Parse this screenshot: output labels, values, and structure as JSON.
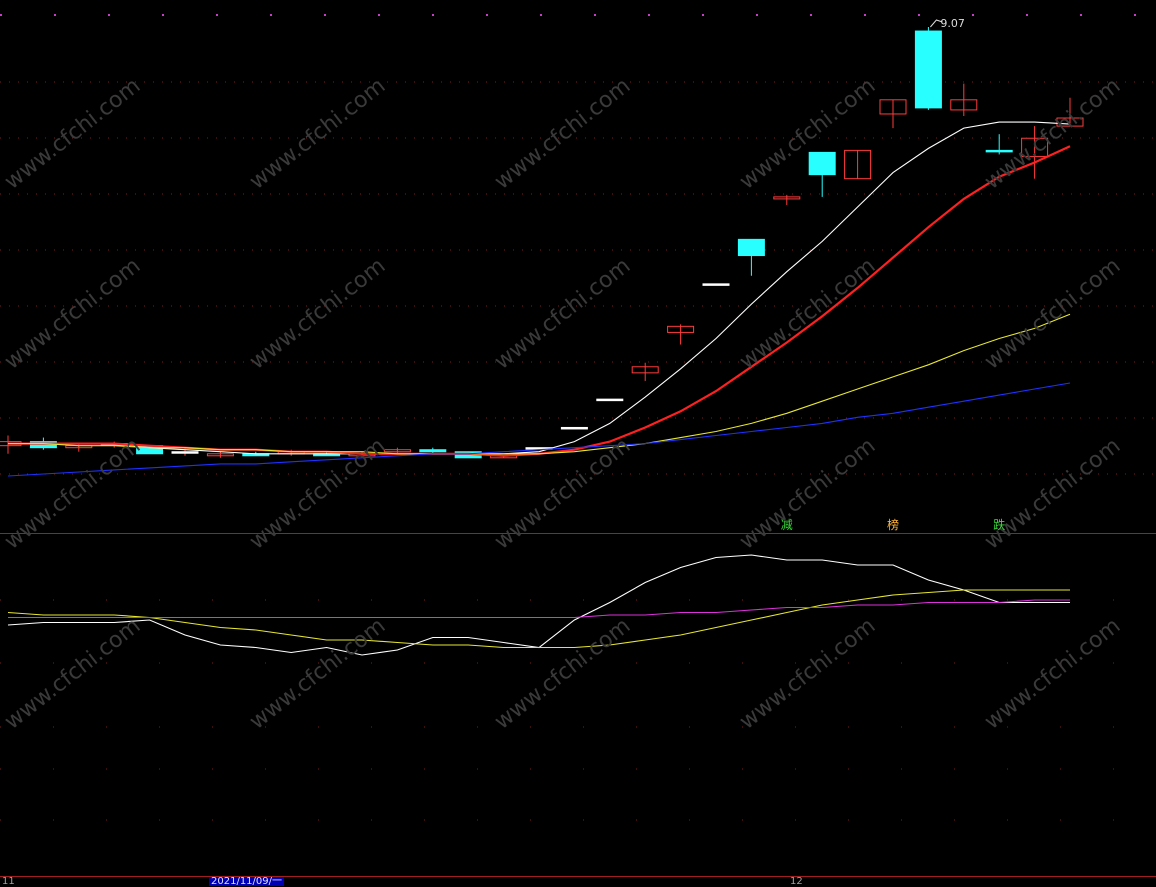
{
  "chart_data": [
    {
      "type": "candlestick",
      "panel": "main",
      "high_label": "9.07",
      "candles": [
        {
          "o": 7.02,
          "h": 7.05,
          "l": 6.96,
          "c": 7.0,
          "up": true
        },
        {
          "o": 7.02,
          "h": 7.04,
          "l": 6.98,
          "c": 6.99,
          "up": false
        },
        {
          "o": 6.99,
          "h": 7.01,
          "l": 6.97,
          "c": 7.0,
          "up": true
        },
        {
          "o": 7.01,
          "h": 7.02,
          "l": 6.99,
          "c": 7.01,
          "up": true
        },
        {
          "o": 7.0,
          "h": 7.0,
          "l": 6.96,
          "c": 6.96,
          "up": false
        },
        {
          "o": 6.97,
          "h": 6.99,
          "l": 6.95,
          "c": 6.97,
          "up": true
        },
        {
          "o": 6.96,
          "h": 6.97,
          "l": 6.94,
          "c": 6.95,
          "up": true
        },
        {
          "o": 6.96,
          "h": 6.97,
          "l": 6.95,
          "c": 6.95,
          "up": false
        },
        {
          "o": 6.96,
          "h": 6.98,
          "l": 6.95,
          "c": 6.97,
          "up": true
        },
        {
          "o": 6.96,
          "h": 6.97,
          "l": 6.95,
          "c": 6.95,
          "up": false
        },
        {
          "o": 6.95,
          "h": 6.97,
          "l": 6.94,
          "c": 6.96,
          "up": true
        },
        {
          "o": 6.97,
          "h": 6.99,
          "l": 6.96,
          "c": 6.98,
          "up": true
        },
        {
          "o": 6.98,
          "h": 6.99,
          "l": 6.96,
          "c": 6.97,
          "up": false
        },
        {
          "o": 6.97,
          "h": 6.97,
          "l": 6.94,
          "c": 6.94,
          "up": false
        },
        {
          "o": 6.94,
          "h": 6.95,
          "l": 6.94,
          "c": 6.95,
          "up": true
        },
        {
          "o": 6.99,
          "h": 6.99,
          "l": 6.99,
          "c": 6.99,
          "up": true
        },
        {
          "o": 7.09,
          "h": 7.09,
          "l": 7.09,
          "c": 7.09,
          "up": true
        },
        {
          "o": 7.23,
          "h": 7.23,
          "l": 7.23,
          "c": 7.23,
          "up": true
        },
        {
          "o": 7.36,
          "h": 7.41,
          "l": 7.32,
          "c": 7.39,
          "up": true
        },
        {
          "o": 7.56,
          "h": 7.6,
          "l": 7.5,
          "c": 7.59,
          "up": true
        },
        {
          "o": 7.8,
          "h": 7.8,
          "l": 7.8,
          "c": 7.8,
          "up": true
        },
        {
          "o": 8.02,
          "h": 8.02,
          "l": 7.84,
          "c": 7.94,
          "up": false
        },
        {
          "o": 8.22,
          "h": 8.24,
          "l": 8.19,
          "c": 8.23,
          "up": true
        },
        {
          "o": 8.45,
          "h": 8.45,
          "l": 8.23,
          "c": 8.34,
          "up": false
        },
        {
          "o": 8.32,
          "h": 8.46,
          "l": 8.32,
          "c": 8.46,
          "up": true
        },
        {
          "o": 8.64,
          "h": 8.71,
          "l": 8.57,
          "c": 8.71,
          "up": true
        },
        {
          "o": 9.05,
          "h": 9.07,
          "l": 8.66,
          "c": 8.67,
          "up": false
        },
        {
          "o": 8.66,
          "h": 8.79,
          "l": 8.63,
          "c": 8.71,
          "up": true
        },
        {
          "o": 8.46,
          "h": 8.54,
          "l": 8.44,
          "c": 8.46,
          "up": false
        },
        {
          "o": 8.43,
          "h": 8.58,
          "l": 8.32,
          "c": 8.52,
          "up": true
        },
        {
          "o": 8.58,
          "h": 8.72,
          "l": 8.58,
          "c": 8.62,
          "up": true
        }
      ],
      "series": [
        {
          "color": "#ffffff",
          "values": [
            7.01,
            7.01,
            7.01,
            7.01,
            6.99,
            6.98,
            6.97,
            6.96,
            6.96,
            6.96,
            6.96,
            6.96,
            6.96,
            6.96,
            6.96,
            6.97,
            7.02,
            7.11,
            7.24,
            7.38,
            7.53,
            7.7,
            7.86,
            8.01,
            8.18,
            8.35,
            8.47,
            8.57,
            8.6,
            8.6,
            8.59
          ]
        },
        {
          "color": "#ff2020",
          "values": [
            7.01,
            7.01,
            7.01,
            7.01,
            7.0,
            6.99,
            6.98,
            6.98,
            6.97,
            6.97,
            6.96,
            6.96,
            6.96,
            6.96,
            6.95,
            6.96,
            6.98,
            7.02,
            7.09,
            7.17,
            7.27,
            7.39,
            7.51,
            7.64,
            7.78,
            7.93,
            8.08,
            8.22,
            8.33,
            8.4,
            8.48
          ]
        },
        {
          "color": "#e6e632",
          "values": [
            7.01,
            7.01,
            7.0,
            7.0,
            6.99,
            6.99,
            6.98,
            6.98,
            6.97,
            6.97,
            6.97,
            6.96,
            6.96,
            6.96,
            6.96,
            6.96,
            6.97,
            6.99,
            7.01,
            7.04,
            7.07,
            7.11,
            7.16,
            7.22,
            7.28,
            7.34,
            7.4,
            7.47,
            7.53,
            7.58,
            7.65
          ]
        },
        {
          "color": "#1e32ff",
          "values": [
            6.85,
            6.86,
            6.87,
            6.88,
            6.89,
            6.9,
            6.91,
            6.91,
            6.92,
            6.93,
            6.94,
            6.95,
            6.96,
            6.96,
            6.97,
            6.98,
            6.99,
            7.0,
            7.01,
            7.03,
            7.05,
            7.07,
            7.09,
            7.11,
            7.14,
            7.16,
            7.19,
            7.22,
            7.25,
            7.28,
            7.31
          ]
        }
      ],
      "signals": [
        {
          "index": 22,
          "text": "减",
          "color": "#3cdc3c"
        },
        {
          "index": 25,
          "text": "榜",
          "color": "#ffb43c"
        },
        {
          "index": 28,
          "text": "跌",
          "color": "#3cdc3c"
        }
      ]
    },
    {
      "type": "line",
      "panel": "indicator",
      "ylim": [
        0,
        100
      ],
      "series": [
        {
          "color": "#ffffff",
          "values": [
            72,
            73,
            73,
            73,
            74,
            68,
            64,
            63,
            61,
            63,
            60,
            62,
            67,
            67,
            65,
            63,
            74,
            81,
            89,
            95,
            99,
            100,
            98,
            98,
            96,
            96,
            90,
            86,
            81,
            81,
            81
          ]
        },
        {
          "color": "#e6e632",
          "values": [
            77,
            76,
            76,
            76,
            75,
            73,
            71,
            70,
            68,
            66,
            66,
            65,
            64,
            64,
            63,
            63,
            63,
            64,
            66,
            68,
            71,
            74,
            77,
            80,
            82,
            84,
            85,
            86,
            86,
            86,
            86
          ]
        },
        {
          "color": "#dc32dc",
          "values": [
            75,
            75,
            75,
            75,
            75,
            75,
            75,
            75,
            75,
            75,
            75,
            75,
            75,
            75,
            75,
            75,
            75,
            76,
            76,
            77,
            77,
            78,
            79,
            79,
            80,
            80,
            81,
            81,
            81,
            82,
            82
          ]
        }
      ]
    }
  ],
  "axis": {
    "left_label": "11",
    "date_label": "2021/11/09/一",
    "month_label": "12"
  },
  "watermark": "www.cfchi.com"
}
